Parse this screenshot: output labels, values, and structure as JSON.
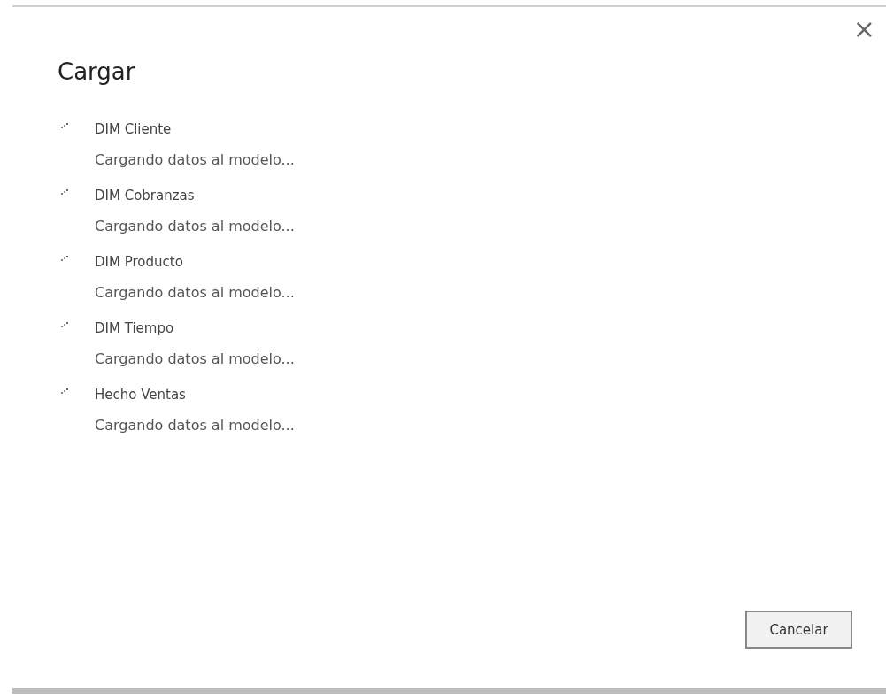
{
  "dialog": {
    "title": "Cargar",
    "close": "×"
  },
  "items": [
    {
      "name": "DIM Cliente",
      "status": "Cargando datos al modelo...",
      "kind": "spinner"
    },
    {
      "name": "DIM Cobranzas",
      "status": "Cargando datos al modelo...",
      "kind": "spinner"
    },
    {
      "name": "DIM Producto",
      "status": "Cargando datos al modelo...",
      "kind": "spinner"
    },
    {
      "name": "DIM Tiempo",
      "status": "Cargando datos al modelo...",
      "kind": "spinner"
    },
    {
      "name": "Hecho Ventas",
      "status": "Cargando datos al modelo...",
      "kind": "spinner"
    }
  ],
  "buttons": [
    "Cancelar"
  ]
}
